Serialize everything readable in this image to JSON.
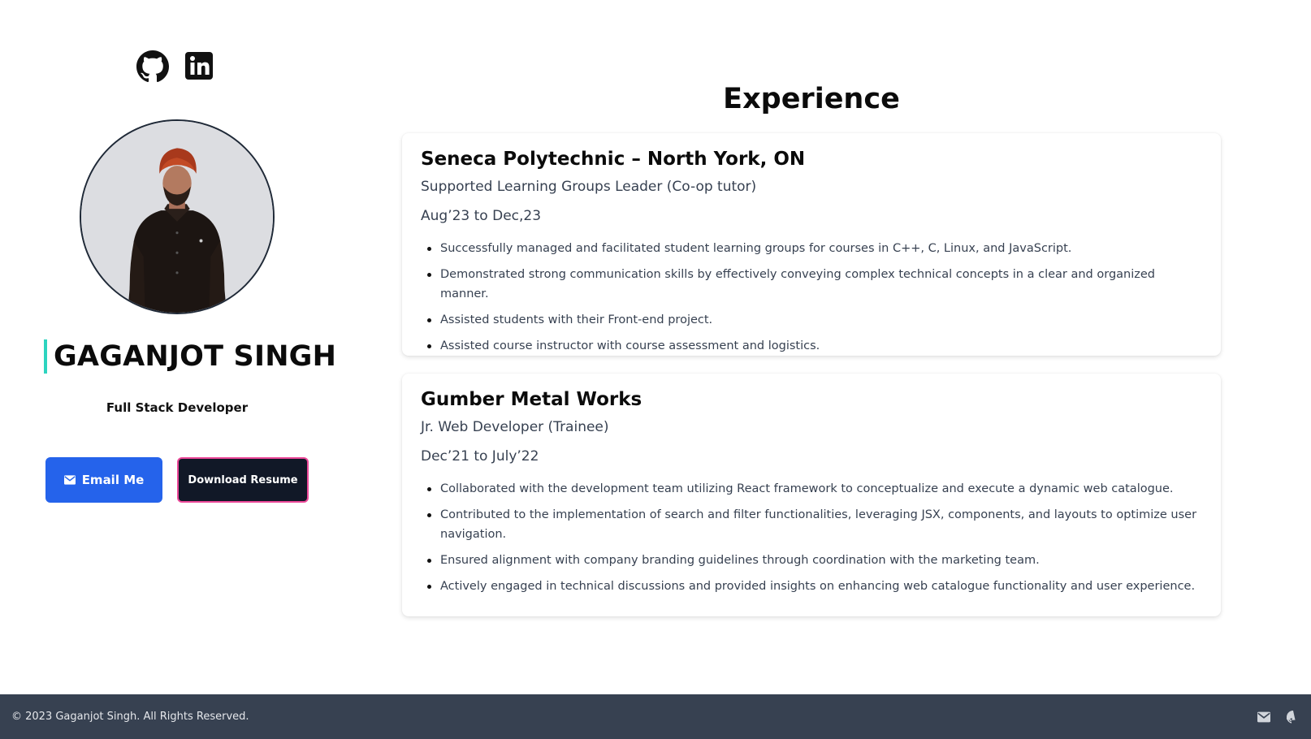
{
  "profile": {
    "name": "GAGANJOT SINGH",
    "role": "Full Stack Developer",
    "email_button": "Email Me",
    "resume_button": "Download Resume"
  },
  "socials": [
    {
      "icon": "github-icon"
    },
    {
      "icon": "linkedin-icon"
    }
  ],
  "experience": {
    "title": "Experience",
    "jobs": [
      {
        "company": "Seneca Polytechnic – North York, ON",
        "position": "Supported Learning Groups Leader (Co-op tutor)",
        "dates": "Aug’23 to Dec,23",
        "duties": [
          "Successfully managed and facilitated student learning groups for courses in C++, C, Linux, and JavaScript.",
          "Demonstrated strong communication skills by effectively conveying complex technical concepts in a clear and organized manner.",
          "Assisted students with their Front-end project.",
          "Assisted course instructor with course assessment and logistics."
        ]
      },
      {
        "company": "Gumber Metal Works",
        "position": "Jr. Web Developer (Trainee)",
        "dates": "Dec’21 to July’22",
        "duties": [
          "Collaborated with the development team utilizing React framework to conceptualize and execute a dynamic web catalogue.",
          "Contributed to the implementation of search and filter functionalities, leveraging JSX, components, and layouts to optimize user navigation.",
          "Ensured alignment with company branding guidelines through coordination with the marketing team.",
          "Actively engaged in technical discussions and provided insights on enhancing web catalogue functionality and user experience."
        ]
      }
    ]
  },
  "footer": {
    "copyright": "© 2023 Gaganjot Singh. All Rights Reserved.",
    "icons": [
      "mail-icon",
      "github-icon"
    ]
  },
  "colors": {
    "accent_bar": "#2dd4bf",
    "email_button": "#2563eb",
    "resume_button": "#111827",
    "resume_border": "#ec4899",
    "footer_bg": "#374151"
  }
}
